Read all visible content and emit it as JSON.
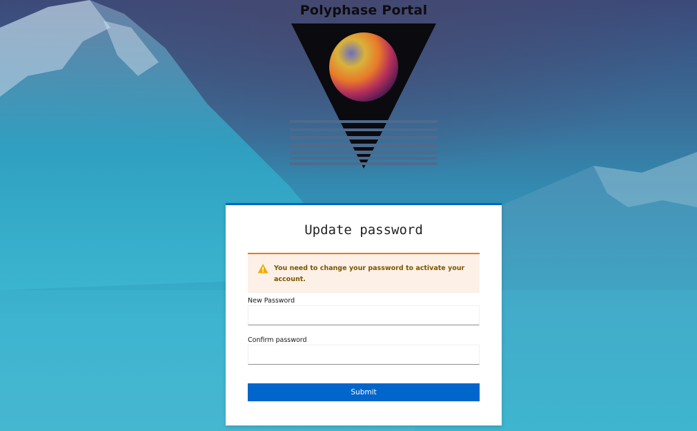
{
  "portal": {
    "title": "Polyphase Portal"
  },
  "form": {
    "title": "Update password",
    "alert": {
      "type": "warning",
      "icon": "warning-triangle-icon",
      "message": "You need to change your password to activate your account."
    },
    "new_password": {
      "label": "New Password",
      "value": ""
    },
    "confirm_password": {
      "label": "Confirm password",
      "value": ""
    },
    "submit_label": "Submit"
  },
  "colors": {
    "primary": "#0066cc",
    "warning_border": "#ec7a08",
    "warning_bg": "#fdf0e7",
    "warning_text": "#795600"
  }
}
